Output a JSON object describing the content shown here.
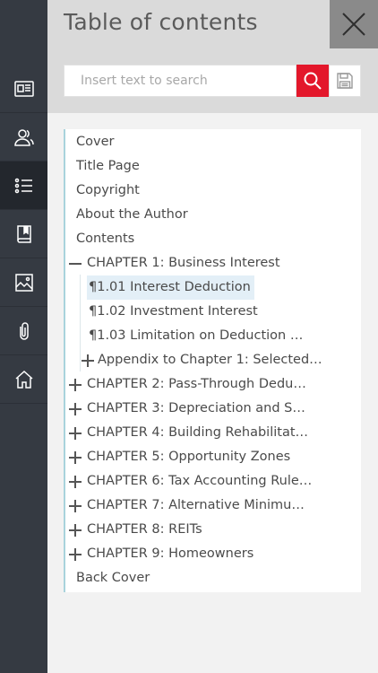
{
  "header": {
    "title": "Table of contents"
  },
  "search": {
    "placeholder": "Insert text to search"
  },
  "rail": {
    "items": [
      {
        "icon": "book-cover-icon"
      },
      {
        "icon": "authors-icon"
      },
      {
        "icon": "toc-list-icon",
        "active": true
      },
      {
        "icon": "bookmark-book-icon"
      },
      {
        "icon": "image-gallery-icon"
      },
      {
        "icon": "paperclip-icon"
      },
      {
        "icon": "home-icon"
      }
    ]
  },
  "toc": {
    "items": [
      {
        "label": "Cover"
      },
      {
        "label": "Title Page"
      },
      {
        "label": "Copyright"
      },
      {
        "label": "About the Author"
      },
      {
        "label": "Contents"
      },
      {
        "label": "CHAPTER 1: Business Interest",
        "expander": "minus"
      },
      {
        "label": "¶1.01 Interest Deduction",
        "selected": true
      },
      {
        "label": "¶1.02 Investment Interest"
      },
      {
        "label": "¶1.03 Limitation on Deduction …"
      },
      {
        "label": "Appendix to Chapter 1: Selected…",
        "expander": "plus"
      },
      {
        "label": "CHAPTER 2: Pass-Through Dedu…",
        "expander": "plus"
      },
      {
        "label": "CHAPTER 3: Depreciation and S…",
        "expander": "plus"
      },
      {
        "label": "CHAPTER 4: Building Rehabilitat…",
        "expander": "plus"
      },
      {
        "label": "CHAPTER 5: Opportunity Zones",
        "expander": "plus"
      },
      {
        "label": "CHAPTER 6: Tax Accounting Rule…",
        "expander": "plus"
      },
      {
        "label": "CHAPTER 7: Alternative Minimu…",
        "expander": "plus"
      },
      {
        "label": "CHAPTER 8: REITs",
        "expander": "plus"
      },
      {
        "label": "CHAPTER 9: Homeowners",
        "expander": "plus"
      },
      {
        "label": "Back Cover"
      }
    ]
  },
  "colors": {
    "accent": "#e3172b",
    "rail": "#353a42",
    "selection": "#e3eff7"
  }
}
